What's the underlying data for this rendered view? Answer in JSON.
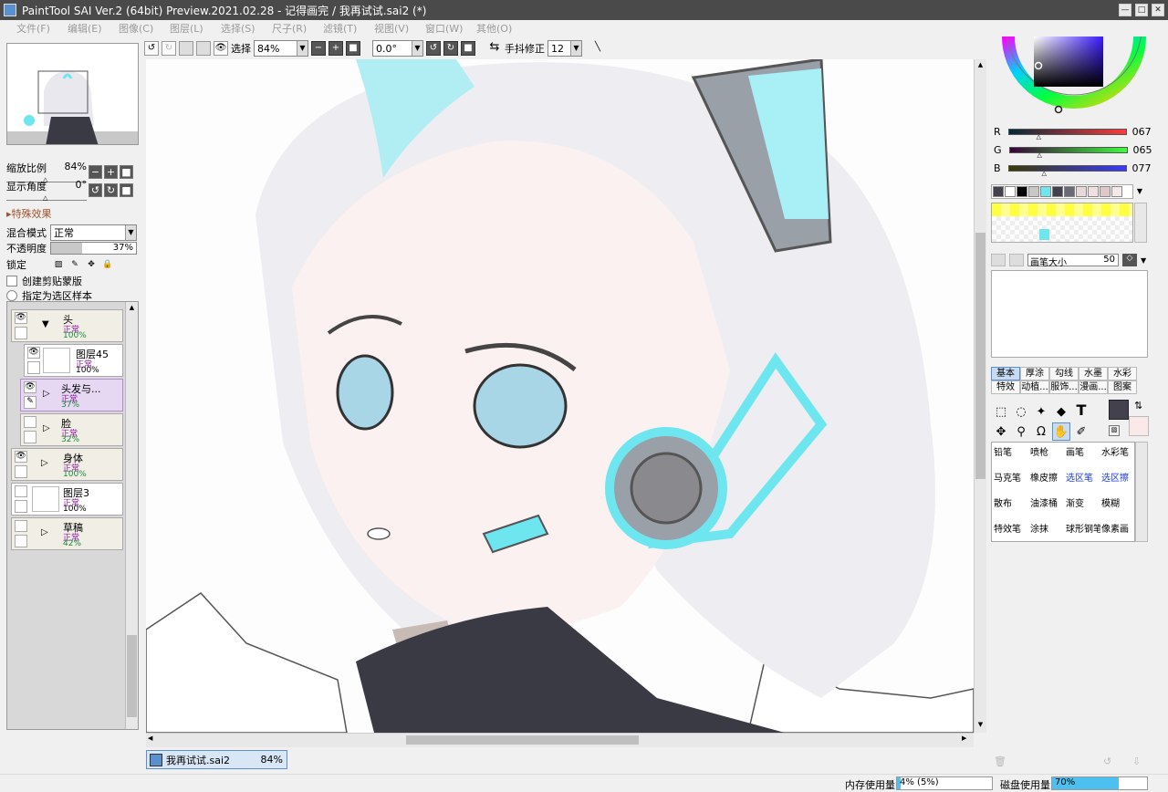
{
  "window": {
    "title": "PaintTool SAI Ver.2 (64bit) Preview.2021.02.28 - 记得画完 / 我再试试.sai2 (*)",
    "minimize": "—",
    "maximize": "□",
    "close": "✕"
  },
  "menu": [
    "文件(F)",
    "编辑(E)",
    "图像(C)",
    "图层(L)",
    "选择(S)",
    "尺子(R)",
    "滤镜(T)",
    "视图(V)",
    "窗口(W)",
    "其他(O)"
  ],
  "toolbar": {
    "select_label": "选择",
    "zoom": "84%",
    "angle": "0.0°",
    "stabilizer_label": "手抖修正",
    "stabilizer_value": "12"
  },
  "navigator": {
    "zoom_label": "缩放比例",
    "zoom_value": "84%",
    "angle_label": "显示角度",
    "angle_value": "0°"
  },
  "layer_props": {
    "effects_label": "特殊效果",
    "blend_label": "混合模式",
    "blend_value": "正常",
    "opacity_label": "不透明度",
    "opacity_value": "37%",
    "opacity_fraction": 0.37,
    "lock_label": "锁定",
    "clip_label": "创建剪贴蒙版",
    "selection_source_label": "指定为选区样本"
  },
  "layers": [
    {
      "name": "头",
      "mode": "正常",
      "opacity": "100%",
      "group": true
    },
    {
      "name": "图层45",
      "mode": "正常",
      "opacity": "100%",
      "group": false
    },
    {
      "name": "头发与...",
      "mode": "正常",
      "opacity": "37%",
      "group": true,
      "active": true
    },
    {
      "name": "脸",
      "mode": "正常",
      "opacity": "32%",
      "group": true
    },
    {
      "name": "身体",
      "mode": "正常",
      "opacity": "100%",
      "group": true
    },
    {
      "name": "图层3",
      "mode": "正常",
      "opacity": "100%",
      "group": false
    },
    {
      "name": "草稿",
      "mode": "正常",
      "opacity": "42%",
      "group": true
    }
  ],
  "color": {
    "r_label": "R",
    "r": "067",
    "g_label": "G",
    "g": "065",
    "b_label": "B",
    "b": "077",
    "current": "#43414d"
  },
  "swatches": [
    "#43414d",
    "#ffffff",
    "#000000",
    "#c8c8c8",
    "#6ee6f0",
    "#43414d",
    "#6a6a78",
    "#e8d8d8",
    "#f0e0e0",
    "#e0c8c8",
    "#f4e8e8"
  ],
  "brush_size": {
    "label": "画笔大小",
    "value": "50"
  },
  "brush_tabs": [
    "基本",
    "厚涂",
    "勾线",
    "水墨",
    "水彩",
    "特效",
    "动植...",
    "服饰...",
    "漫画...",
    "图案"
  ],
  "brushes": [
    "铅笔",
    "喷枪",
    "画笔",
    "水彩笔",
    "马克笔",
    "橡皮擦",
    "选区笔",
    "选区擦",
    "散布",
    "油漆桶",
    "渐变",
    "模糊",
    "特效笔",
    "涂抹",
    "球形钢笔",
    "像素画"
  ],
  "document": {
    "name": "我再试试.sai2",
    "zoom": "84%"
  },
  "status": {
    "memory_label": "内存使用量",
    "memory_value": "4% (5%)",
    "memory_fraction": 0.04,
    "disk_label": "磁盘使用量",
    "disk_value": "70%",
    "disk_fraction": 0.7
  }
}
